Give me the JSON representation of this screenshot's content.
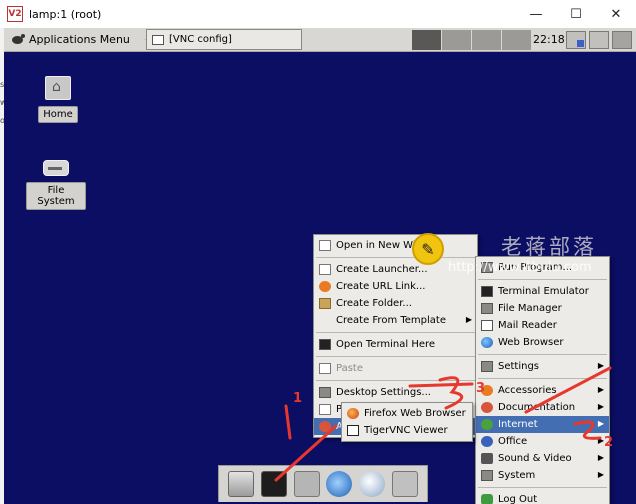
{
  "window": {
    "title": "lamp:1 (root)",
    "controls": [
      "—",
      "☐",
      "✕"
    ]
  },
  "panel": {
    "app_menu_label": "Applications Menu",
    "task_label": "[VNC config]",
    "clock": "22:18",
    "workspaces": 4
  },
  "desktop_icons": [
    {
      "label": "Home"
    },
    {
      "label": "File System"
    }
  ],
  "desktop_menu": {
    "items": [
      {
        "label": "Open in New Window",
        "icon": "window-icon"
      },
      {
        "sep": true
      },
      {
        "label": "Create Launcher...",
        "icon": "launcher-icon"
      },
      {
        "label": "Create URL Link...",
        "icon": "link-icon"
      },
      {
        "label": "Create Folder...",
        "icon": "folder-icon"
      },
      {
        "label": "Create From Template",
        "icon": "none",
        "submenu": true
      },
      {
        "sep": true
      },
      {
        "label": "Open Terminal Here",
        "icon": "terminal-icon"
      },
      {
        "sep": true
      },
      {
        "label": "Paste",
        "icon": "paste-icon",
        "disabled": true
      },
      {
        "sep": true
      },
      {
        "label": "Desktop Settings...",
        "icon": "settings-icon"
      },
      {
        "label": "Properties...",
        "icon": "properties-icon"
      },
      {
        "label": "Applications",
        "icon": "apps-icon",
        "highlight": true
      }
    ]
  },
  "apps_menu": {
    "items": [
      {
        "label": "Run Program...",
        "icon": "run-icon"
      },
      {
        "sep": true
      },
      {
        "label": "Terminal Emulator",
        "icon": "terminal-icon"
      },
      {
        "label": "File Manager",
        "icon": "file-manager-icon"
      },
      {
        "label": "Mail Reader",
        "icon": "mail-icon"
      },
      {
        "label": "Web Browser",
        "icon": "web-browser-icon"
      },
      {
        "sep": true
      },
      {
        "label": "Settings",
        "icon": "settings-icon",
        "submenu": true
      },
      {
        "sep": true
      },
      {
        "label": "Accessories",
        "icon": "accessories-icon",
        "submenu": true
      },
      {
        "label": "Documentation",
        "icon": "help-icon",
        "submenu": true
      },
      {
        "label": "Internet",
        "icon": "internet-icon",
        "submenu": true,
        "highlight": true
      },
      {
        "label": "Office",
        "icon": "office-icon",
        "submenu": true
      },
      {
        "label": "Sound & Video",
        "icon": "sound-icon",
        "submenu": true
      },
      {
        "label": "System",
        "icon": "system-icon",
        "submenu": true
      },
      {
        "sep": true
      },
      {
        "label": "Log Out",
        "icon": "logout-icon"
      }
    ]
  },
  "internet_menu": {
    "items": [
      {
        "label": "Firefox Web Browser",
        "icon": "firefox-icon"
      },
      {
        "label": "TigerVNC Viewer",
        "icon": "vnc-icon"
      }
    ]
  },
  "dock": [
    "show-desktop-icon",
    "terminal-icon",
    "file-manager-icon",
    "web-browser-icon",
    "search-icon",
    "files-icon"
  ],
  "watermark": {
    "site_name": "老蒋部落",
    "url": "http://www.itbulu.com"
  },
  "annotations": [
    "1",
    "2",
    "3"
  ],
  "stray_left_text": [
    "s",
    "w",
    "o"
  ]
}
